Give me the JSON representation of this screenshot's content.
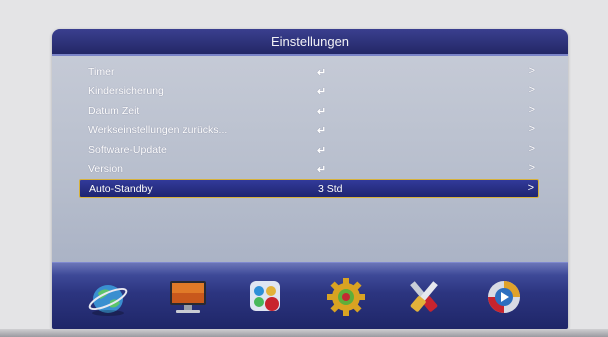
{
  "menu": {
    "title": "Einstellungen",
    "items": [
      {
        "label": "Timer",
        "value": "↵",
        "arrow": ">"
      },
      {
        "label": "Kindersicherung",
        "value": "↵",
        "arrow": ">"
      },
      {
        "label": "Datum Zeit",
        "value": "↵",
        "arrow": ">"
      },
      {
        "label": "Werkseinstellungen zurücks...",
        "value": "↵",
        "arrow": ">"
      },
      {
        "label": "Software-Update",
        "value": "↵",
        "arrow": ">"
      },
      {
        "label": "Version",
        "value": "↵",
        "arrow": ">"
      },
      {
        "label": "Auto-Standby",
        "value": "3 Std",
        "arrow": ">"
      }
    ],
    "selected_index": 6
  },
  "dock": {
    "icons": [
      "globe-icon",
      "monitor-icon",
      "color-palette-icon",
      "gear-icon",
      "tools-icon",
      "play-icon"
    ],
    "selected": "gear-icon"
  },
  "colors": {
    "title_bar": "#2e3380",
    "selection": "#262c84",
    "selection_border": "#d7b13a",
    "dock": "#2c3580"
  }
}
